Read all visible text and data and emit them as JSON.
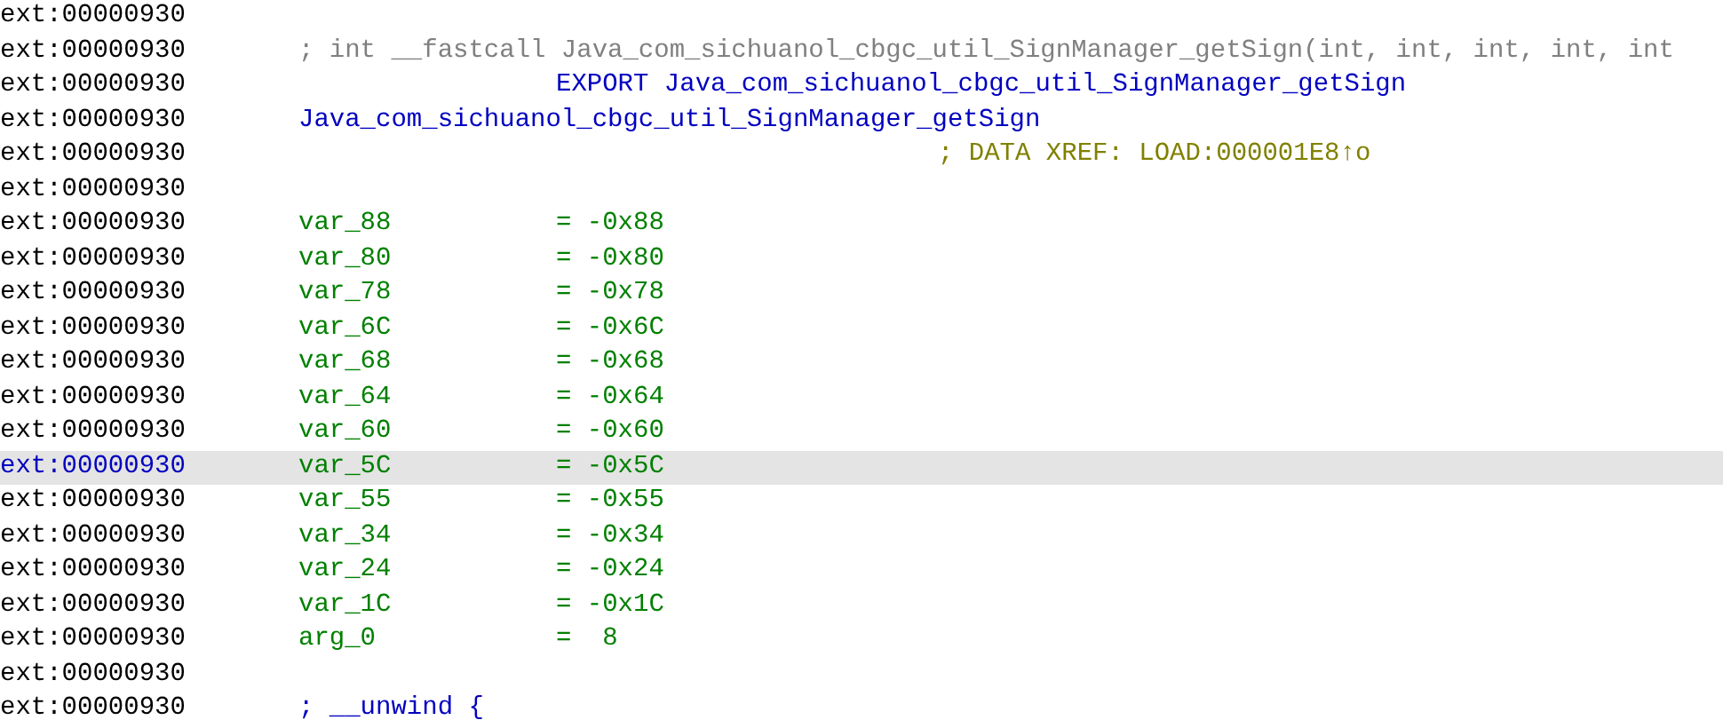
{
  "lines": [
    {
      "address": "ext:00000930",
      "selected": false,
      "kind": "blank"
    },
    {
      "address": "ext:00000930",
      "selected": false,
      "kind": "comment",
      "text": "; int __fastcall Java_com_sichuanol_cbgc_util_SignManager_getSign(int, int, int, int, int"
    },
    {
      "address": "ext:00000930",
      "selected": false,
      "kind": "export",
      "text": "EXPORT Java_com_sichuanol_cbgc_util_SignManager_getSign"
    },
    {
      "address": "ext:00000930",
      "selected": false,
      "kind": "label",
      "text": "Java_com_sichuanol_cbgc_util_SignManager_getSign"
    },
    {
      "address": "ext:00000930",
      "selected": false,
      "kind": "xref",
      "text": "; DATA XREF: LOAD:000001E8↑o"
    },
    {
      "address": "ext:00000930",
      "selected": false,
      "kind": "blank"
    },
    {
      "address": "ext:00000930",
      "selected": false,
      "kind": "stackvar",
      "name": "var_88",
      "value": "= -0x88"
    },
    {
      "address": "ext:00000930",
      "selected": false,
      "kind": "stackvar",
      "name": "var_80",
      "value": "= -0x80"
    },
    {
      "address": "ext:00000930",
      "selected": false,
      "kind": "stackvar",
      "name": "var_78",
      "value": "= -0x78"
    },
    {
      "address": "ext:00000930",
      "selected": false,
      "kind": "stackvar",
      "name": "var_6C",
      "value": "= -0x6C"
    },
    {
      "address": "ext:00000930",
      "selected": false,
      "kind": "stackvar",
      "name": "var_68",
      "value": "= -0x68"
    },
    {
      "address": "ext:00000930",
      "selected": false,
      "kind": "stackvar",
      "name": "var_64",
      "value": "= -0x64"
    },
    {
      "address": "ext:00000930",
      "selected": false,
      "kind": "stackvar",
      "name": "var_60",
      "value": "= -0x60"
    },
    {
      "address": "ext:00000930",
      "selected": true,
      "kind": "stackvar",
      "name": "var_5C",
      "value": "= -0x5C"
    },
    {
      "address": "ext:00000930",
      "selected": false,
      "kind": "stackvar",
      "name": "var_55",
      "value": "= -0x55"
    },
    {
      "address": "ext:00000930",
      "selected": false,
      "kind": "stackvar",
      "name": "var_34",
      "value": "= -0x34"
    },
    {
      "address": "ext:00000930",
      "selected": false,
      "kind": "stackvar",
      "name": "var_24",
      "value": "= -0x24"
    },
    {
      "address": "ext:00000930",
      "selected": false,
      "kind": "stackvar",
      "name": "var_1C",
      "value": "= -0x1C"
    },
    {
      "address": "ext:00000930",
      "selected": false,
      "kind": "stackvar",
      "name": "arg_0",
      "value": "=  8"
    },
    {
      "address": "ext:00000930",
      "selected": false,
      "kind": "blank"
    },
    {
      "address": "ext:00000930",
      "selected": false,
      "kind": "unwind",
      "text": "; __unwind {"
    }
  ]
}
